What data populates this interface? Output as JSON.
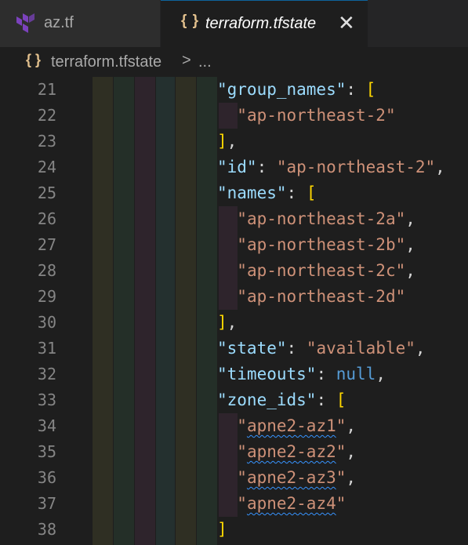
{
  "tabs": [
    {
      "label": "az.tf",
      "icon": "terraform-icon",
      "active": false
    },
    {
      "label": "terraform.tfstate",
      "icon": "json-braces-icon",
      "active": true
    }
  ],
  "breadcrumb": {
    "file": "terraform.tfstate",
    "separator": ">",
    "more": "..."
  },
  "colors": {
    "key": "#9cdcfe",
    "string": "#ce9178",
    "bracket": "#ffd700",
    "null": "#569cd6",
    "line_number": "#858585",
    "squiggle": "#3794ff"
  },
  "lines": [
    {
      "n": "21",
      "t": [
        [
          "k",
          "\"group_names\""
        ],
        [
          "p",
          ": "
        ],
        [
          "b",
          "["
        ]
      ]
    },
    {
      "n": "22",
      "t": [
        [
          "p",
          "  "
        ],
        [
          "s",
          "\"ap-northeast-2\""
        ]
      ]
    },
    {
      "n": "23",
      "t": [
        [
          "b",
          "]"
        ],
        [
          "p",
          ","
        ]
      ]
    },
    {
      "n": "24",
      "t": [
        [
          "k",
          "\"id\""
        ],
        [
          "p",
          ": "
        ],
        [
          "s",
          "\"ap-northeast-2\""
        ],
        [
          "p",
          ","
        ]
      ]
    },
    {
      "n": "25",
      "t": [
        [
          "k",
          "\"names\""
        ],
        [
          "p",
          ": "
        ],
        [
          "b",
          "["
        ]
      ]
    },
    {
      "n": "26",
      "t": [
        [
          "p",
          "  "
        ],
        [
          "s",
          "\"ap-northeast-2a\""
        ],
        [
          "p",
          ","
        ]
      ]
    },
    {
      "n": "27",
      "t": [
        [
          "p",
          "  "
        ],
        [
          "s",
          "\"ap-northeast-2b\""
        ],
        [
          "p",
          ","
        ]
      ]
    },
    {
      "n": "28",
      "t": [
        [
          "p",
          "  "
        ],
        [
          "s",
          "\"ap-northeast-2c\""
        ],
        [
          "p",
          ","
        ]
      ]
    },
    {
      "n": "29",
      "t": [
        [
          "p",
          "  "
        ],
        [
          "s",
          "\"ap-northeast-2d\""
        ]
      ]
    },
    {
      "n": "30",
      "t": [
        [
          "b",
          "]"
        ],
        [
          "p",
          ","
        ]
      ]
    },
    {
      "n": "31",
      "t": [
        [
          "k",
          "\"state\""
        ],
        [
          "p",
          ": "
        ],
        [
          "s",
          "\"available\""
        ],
        [
          "p",
          ","
        ]
      ]
    },
    {
      "n": "32",
      "t": [
        [
          "k",
          "\"timeouts\""
        ],
        [
          "p",
          ": "
        ],
        [
          "n",
          "null"
        ],
        [
          "p",
          ","
        ]
      ]
    },
    {
      "n": "33",
      "t": [
        [
          "k",
          "\"zone_ids\""
        ],
        [
          "p",
          ": "
        ],
        [
          "b",
          "["
        ]
      ]
    },
    {
      "n": "34",
      "t": [
        [
          "p",
          "  "
        ],
        [
          "s",
          "\""
        ],
        [
          "sw",
          "apne2-az1"
        ],
        [
          "s",
          "\""
        ],
        [
          "p",
          ","
        ]
      ]
    },
    {
      "n": "35",
      "t": [
        [
          "p",
          "  "
        ],
        [
          "s",
          "\""
        ],
        [
          "sw",
          "apne2-az2"
        ],
        [
          "s",
          "\""
        ],
        [
          "p",
          ","
        ]
      ]
    },
    {
      "n": "36",
      "t": [
        [
          "p",
          "  "
        ],
        [
          "s",
          "\""
        ],
        [
          "sw",
          "apne2-az3"
        ],
        [
          "s",
          "\""
        ],
        [
          "p",
          ","
        ]
      ]
    },
    {
      "n": "37",
      "t": [
        [
          "p",
          "  "
        ],
        [
          "s",
          "\""
        ],
        [
          "sw",
          "apne2-az4"
        ],
        [
          "s",
          "\""
        ]
      ]
    },
    {
      "n": "38",
      "t": [
        [
          "b",
          "]"
        ]
      ]
    }
  ]
}
